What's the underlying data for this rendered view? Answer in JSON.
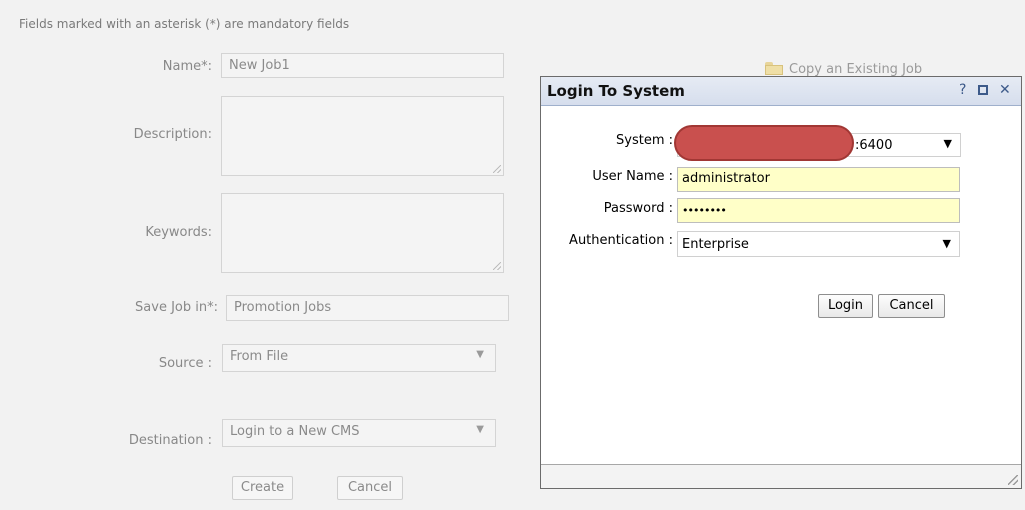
{
  "form": {
    "mandatory_note": "Fields marked with an asterisk (*) are mandatory fields",
    "name_label": "Name*:",
    "name_value": "New Job1",
    "description_label": "Description:",
    "keywords_label": "Keywords:",
    "save_in_label": "Save Job in*:",
    "save_in_value": "Promotion Jobs",
    "source_label": "Source :",
    "source_value": "From File",
    "destination_label": "Destination :",
    "destination_value": "Login to a New CMS",
    "create_label": "Create",
    "cancel_label": "Cancel",
    "copy_existing_label": "Copy an Existing Job"
  },
  "dialog": {
    "title": "Login To System",
    "help_glyph": "?",
    "close_glyph": "✕",
    "system_label": "System :",
    "system_value_suffix": ":6400",
    "username_label": "User Name :",
    "username_value": "administrator",
    "password_label": "Password :",
    "password_value": "••••••••",
    "auth_label": "Authentication :",
    "auth_value": "Enterprise",
    "login_label": "Login",
    "cancel_label": "Cancel",
    "dropdown_glyph": "▼"
  },
  "colors": {
    "highlight_field": "#ffffc8",
    "redaction": "#c9504e",
    "titlebar": "#d6deed"
  }
}
